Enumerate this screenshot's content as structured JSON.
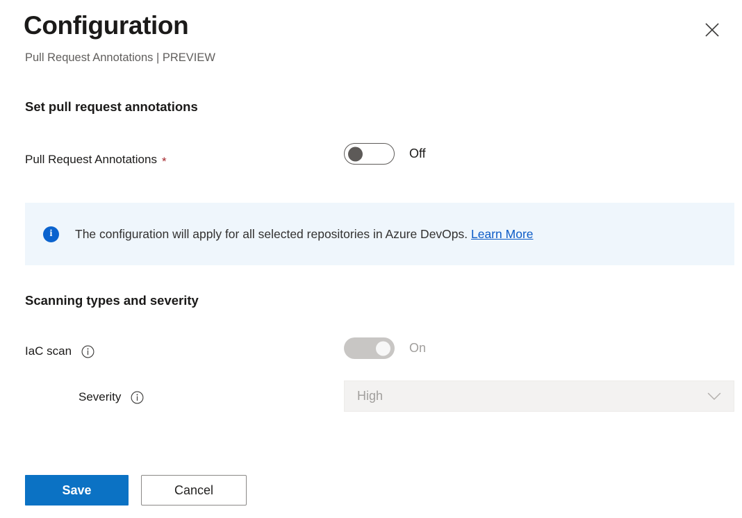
{
  "header": {
    "title": "Configuration",
    "subtitle": "Pull Request Annotations | PREVIEW",
    "close_icon": "close-icon"
  },
  "sections": {
    "annotations": {
      "heading": "Set pull request annotations",
      "field": {
        "label": "Pull Request Annotations",
        "required_marker": "*",
        "toggle_state": "Off",
        "toggle_label": "Off"
      }
    },
    "scanning": {
      "heading": "Scanning types and severity",
      "iac": {
        "label": "IaC scan",
        "info_icon": "info-circle-icon",
        "toggle_state": "On",
        "toggle_label": "On",
        "disabled": true
      },
      "severity": {
        "label": "Severity",
        "info_icon": "info-circle-icon",
        "selected_value": "High",
        "chevron_icon": "chevron-down-icon",
        "disabled": true,
        "options": [
          "High"
        ]
      }
    }
  },
  "banner": {
    "icon": "info-icon",
    "icon_glyph": "i",
    "text": "The configuration will apply for all selected repositories in Azure DevOps.",
    "link_text": "Learn More",
    "background_color": "#EFF6FC",
    "icon_color": "#0B63CE",
    "link_color": "#0C5BC7"
  },
  "footer": {
    "save_label": "Save",
    "cancel_label": "Cancel",
    "primary_color": "#0B72C4"
  }
}
